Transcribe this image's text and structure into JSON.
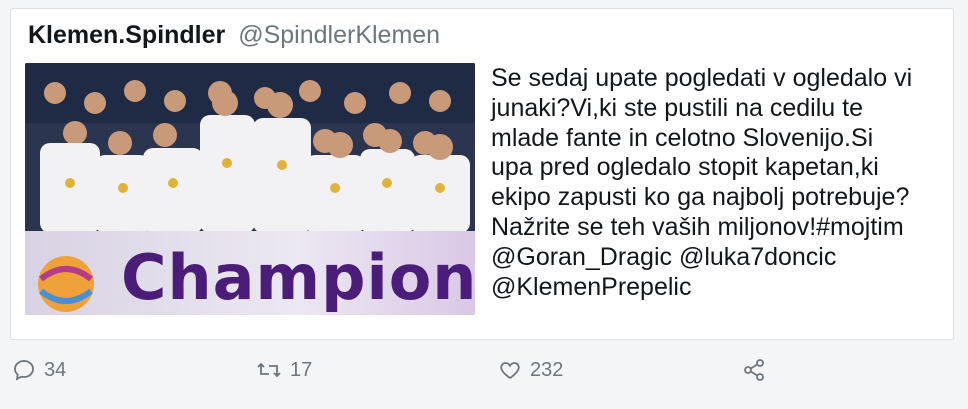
{
  "tweet": {
    "display_name": "Klemen.Spindler",
    "handle": "@SpindlerKlemen",
    "text_lines": [
      "Se sedaj upate pogledati v ogledalo vi",
      "junaki?Vi,ki ste pustili na cedilu te",
      "mlade fante in celotno Slovenijo.Si",
      "upa pred ogledalo stopit kapetan,ki",
      "ekipo zapusti ko ga najbolj potrebuje?",
      "Nažrite se teh vaših miljonov!#mojtim",
      "@Goran_Dragic @luka7doncic",
      "@KlemenPrepelic"
    ],
    "media": {
      "banner_text": "Champions",
      "alt": "photo"
    }
  },
  "actions": {
    "reply": {
      "icon": "reply-icon",
      "count": "34"
    },
    "retweet": {
      "icon": "retweet-icon",
      "count": "17"
    },
    "like": {
      "icon": "heart-icon",
      "count": "232"
    },
    "share": {
      "icon": "share-icon"
    }
  },
  "colors": {
    "text": "#14171a",
    "muted": "#6e767d",
    "banner_text": "#4a1d78"
  }
}
